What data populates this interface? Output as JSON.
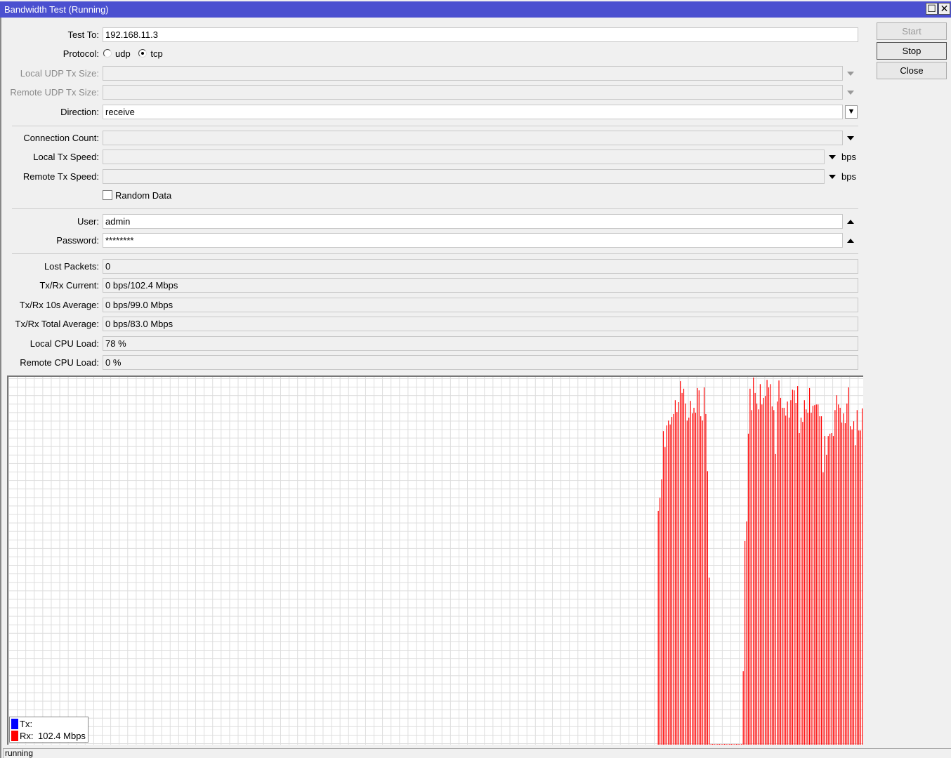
{
  "window": {
    "title": "Bandwidth Test (Running)",
    "maximize_icon": "maximize-icon",
    "close_icon": "close-icon"
  },
  "buttons": {
    "start": "Start",
    "stop": "Stop",
    "close": "Close"
  },
  "form": {
    "test_to": {
      "label": "Test To:",
      "value": "192.168.11.3"
    },
    "protocol": {
      "label": "Protocol:",
      "options": [
        "udp",
        "tcp"
      ],
      "selected": "tcp"
    },
    "local_udp_tx_size": {
      "label": "Local UDP Tx Size:",
      "value": ""
    },
    "remote_udp_tx_size": {
      "label": "Remote UDP Tx Size:",
      "value": ""
    },
    "direction": {
      "label": "Direction:",
      "value": "receive"
    },
    "connection_count": {
      "label": "Connection Count:",
      "value": ""
    },
    "local_tx_speed": {
      "label": "Local Tx Speed:",
      "value": "",
      "unit": "bps"
    },
    "remote_tx_speed": {
      "label": "Remote Tx Speed:",
      "value": "",
      "unit": "bps"
    },
    "random_data": {
      "label": "Random Data",
      "checked": false
    },
    "user": {
      "label": "User:",
      "value": "admin"
    },
    "password": {
      "label": "Password:",
      "value": "********"
    }
  },
  "stats": {
    "lost_packets": {
      "label": "Lost Packets:",
      "value": "0"
    },
    "txrx_current": {
      "label": "Tx/Rx Current:",
      "value": "0 bps/102.4 Mbps"
    },
    "txrx_10s_avg": {
      "label": "Tx/Rx 10s Average:",
      "value": "0 bps/99.0 Mbps"
    },
    "txrx_total_avg": {
      "label": "Tx/Rx Total Average:",
      "value": "0 bps/83.0 Mbps"
    },
    "local_cpu": {
      "label": "Local CPU Load:",
      "value": "78 %"
    },
    "remote_cpu": {
      "label": "Remote CPU Load:",
      "value": "0 %"
    }
  },
  "chart_data": {
    "type": "bar",
    "ylabel": "Mbps",
    "ylim": [
      0,
      112
    ],
    "grid": true,
    "legend_placement": "bottom-left",
    "colors": {
      "tx": "#0000ff",
      "rx": "#ff0000"
    },
    "legend": [
      {
        "name": "Tx:",
        "value": ""
      },
      {
        "name": "Rx:",
        "value": "102.4 Mbps"
      }
    ],
    "series": [
      {
        "name": "Rx",
        "values": [
          71.2,
          75.2,
          80.8,
          95.5,
          90.6,
          97.2,
          98.7,
          97.5,
          99.8,
          100.7,
          104.9,
          101.3,
          104.3,
          110.7,
          107.1,
          108.4,
          103.9,
          98.7,
          99.6,
          104.7,
          100.9,
          102.6,
          101.1,
          108.6,
          107.9,
          100.0,
          98.7,
          108.8,
          100.7,
          83.3,
          50.9,
          0,
          0,
          0,
          0,
          0,
          0,
          0,
          0,
          0,
          0,
          0,
          0,
          0,
          0,
          0,
          0,
          0,
          0,
          0,
          22.4,
          62.0,
          68.0,
          94.7,
          108.4,
          101.9,
          111.8,
          107.1,
          103.9,
          102.1,
          109.8,
          103.6,
          105.6,
          106.2,
          111.1,
          108.8,
          109.8,
          103.0,
          101.9,
          88.5,
          104.5,
          110.9,
          105.6,
          102.6,
          102.6,
          100.2,
          104.5,
          99.6,
          104.9,
          108.1,
          107.9,
          104.1,
          109.2,
          94.9,
          99.6,
          98.3,
          104.9,
          102.1,
          101.1,
          108.6,
          101.1,
          103.2,
          103.4,
          103.6,
          103.6,
          100.0,
          100.0,
          82.9,
          94.0,
          88.3,
          94.0,
          94.7,
          94.9,
          94.0,
          101.9,
          106.4,
          103.6,
          102.6,
          98.1,
          100.9,
          97.9,
          103.9,
          108.8,
          97.0,
          96.0,
          98.5,
          91.2,
          101.9,
          95.7,
          95.7,
          102.4
        ]
      }
    ]
  },
  "status": "running"
}
